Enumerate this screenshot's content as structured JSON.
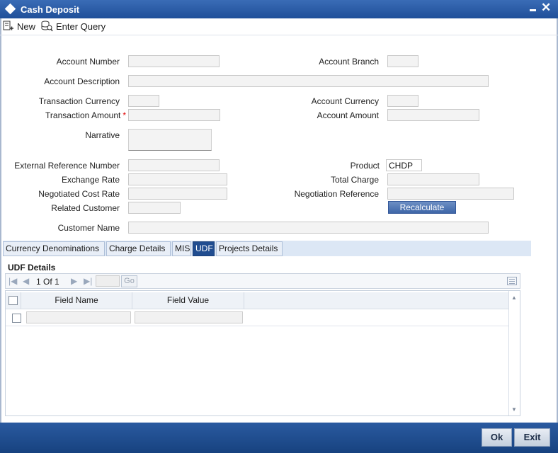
{
  "window": {
    "title": "Cash Deposit"
  },
  "toolbar": {
    "new_label": "New",
    "enter_query_label": "Enter Query"
  },
  "form": {
    "account_number": {
      "label": "Account Number",
      "value": ""
    },
    "account_branch": {
      "label": "Account Branch",
      "value": ""
    },
    "account_description": {
      "label": "Account Description",
      "value": ""
    },
    "transaction_currency": {
      "label": "Transaction Currency",
      "value": ""
    },
    "account_currency": {
      "label": "Account Currency",
      "value": ""
    },
    "transaction_amount": {
      "label": "Transaction Amount",
      "required_mark": "*",
      "value": ""
    },
    "account_amount": {
      "label": "Account Amount",
      "value": ""
    },
    "narrative": {
      "label": "Narrative",
      "value": ""
    },
    "external_reference_number": {
      "label": "External Reference Number",
      "value": ""
    },
    "product": {
      "label": "Product",
      "value": "CHDP"
    },
    "exchange_rate": {
      "label": "Exchange Rate",
      "value": ""
    },
    "total_charge": {
      "label": "Total Charge",
      "value": ""
    },
    "negotiated_cost_rate": {
      "label": "Negotiated Cost Rate",
      "value": ""
    },
    "negotiation_reference": {
      "label": "Negotiation Reference",
      "value": ""
    },
    "related_customer": {
      "label": "Related Customer",
      "value": ""
    },
    "recalculate_label": "Recalculate",
    "customer_name": {
      "label": "Customer Name",
      "value": ""
    }
  },
  "tabs": [
    {
      "label": "Currency Denominations",
      "active": false
    },
    {
      "label": "Charge Details",
      "active": false
    },
    {
      "label": "MIS",
      "active": false
    },
    {
      "label": "UDF",
      "active": true
    },
    {
      "label": "Projects Details",
      "active": false
    }
  ],
  "udf": {
    "section_title": "UDF Details",
    "pager": {
      "current": "1",
      "of_label": "Of",
      "total": "1",
      "go_label": "Go"
    },
    "columns": [
      "Field Name",
      "Field Value"
    ],
    "rows": [
      {
        "field_name": "",
        "field_value": ""
      }
    ]
  },
  "footer": {
    "ok_label": "Ok",
    "exit_label": "Exit"
  },
  "colors": {
    "titlebar": "#1f4f99",
    "active_tab": "#204d90",
    "footer": "#1e4a8c",
    "required": "#dd0000"
  }
}
